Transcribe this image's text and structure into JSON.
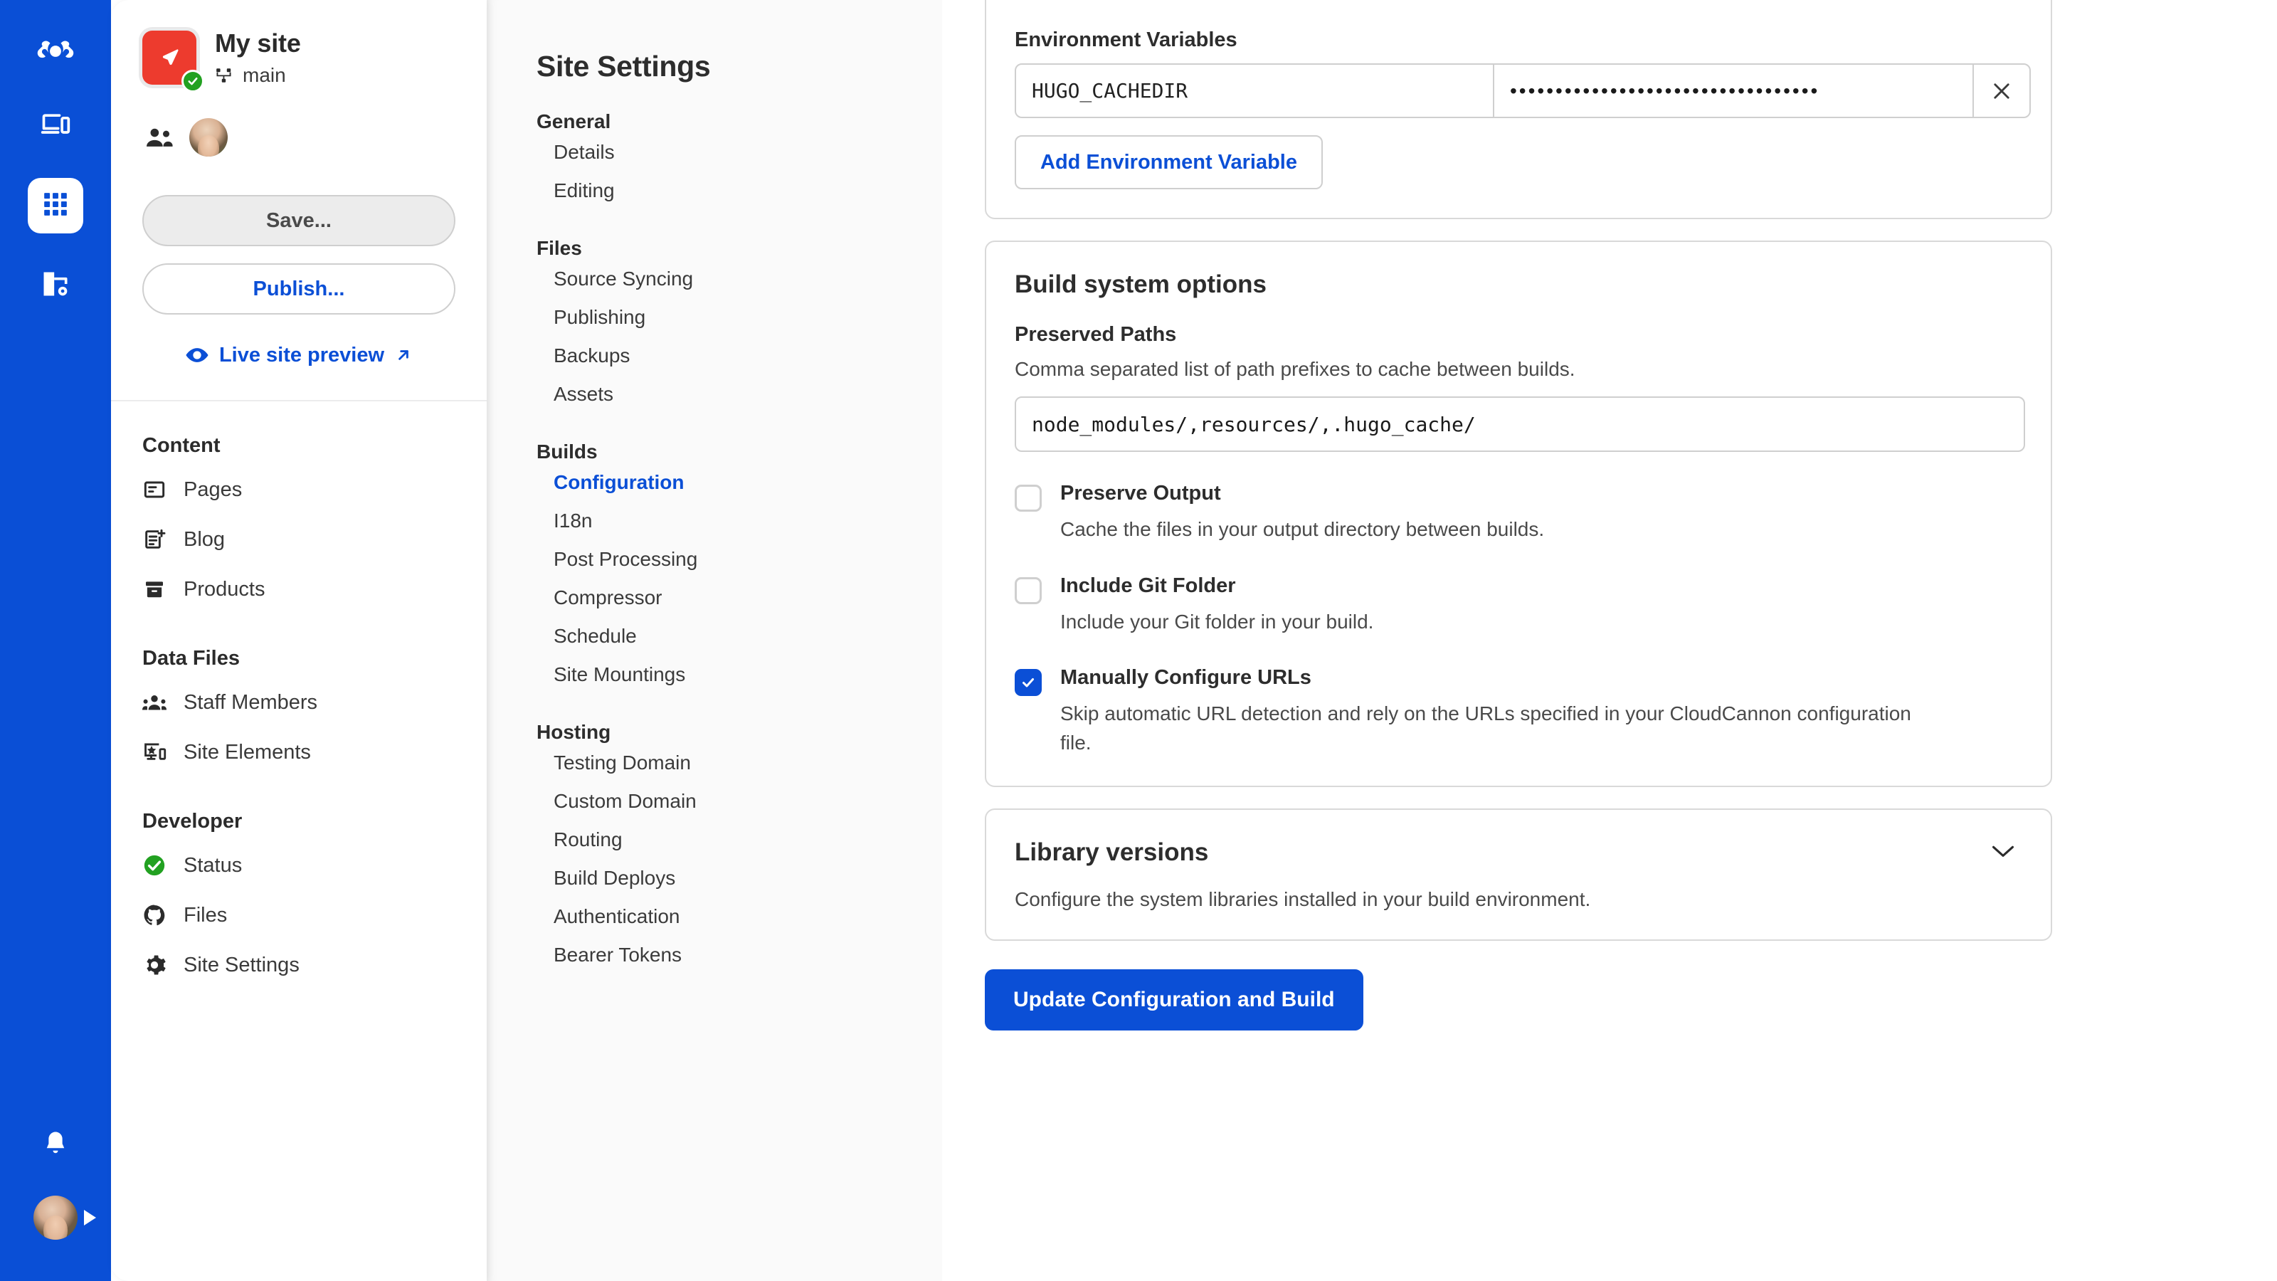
{
  "colors": {
    "rail_blue": "#0A4FD6",
    "accent_blue": "#0B4FD6",
    "site_logo_red": "#ED3B2E",
    "status_green": "#22A121"
  },
  "rail": {
    "logo_icon": "cloudcannon-logo-icon",
    "items": [
      {
        "icon": "devices-preview-icon",
        "active": false
      },
      {
        "icon": "apps-grid-icon",
        "active": true
      },
      {
        "icon": "site-settings-building-icon",
        "active": false
      }
    ],
    "bell_icon": "notification-bell-icon",
    "avatar_icon": "user-avatar",
    "expand_caret_icon": "caret-right-icon"
  },
  "sidebar": {
    "site_name": "My site",
    "branch_icon": "git-branch-icon",
    "branch_name": "main",
    "members_icon": "people-icon",
    "save_label": "Save...",
    "publish_label": "Publish...",
    "live_preview_label": "Live site preview",
    "live_preview_icon": "eye-icon",
    "live_preview_external_icon": "external-link-arrow-icon",
    "groups": [
      {
        "heading": "Content",
        "items": [
          {
            "label": "Pages",
            "icon": "pages-icon"
          },
          {
            "label": "Blog",
            "icon": "blog-post-add-icon"
          },
          {
            "label": "Products",
            "icon": "products-box-icon"
          }
        ]
      },
      {
        "heading": "Data Files",
        "items": [
          {
            "label": "Staff Members",
            "icon": "staff-members-people-icon"
          },
          {
            "label": "Site Elements",
            "icon": "site-elements-screen-icon"
          }
        ]
      },
      {
        "heading": "Developer",
        "items": [
          {
            "label": "Status",
            "icon": "status-check-circle-icon"
          },
          {
            "label": "Files",
            "icon": "github-octocat-icon"
          },
          {
            "label": "Site Settings",
            "icon": "gear-icon"
          }
        ]
      }
    ]
  },
  "settings_nav": {
    "title": "Site Settings",
    "groups": [
      {
        "heading": "General",
        "items": [
          {
            "label": "Details",
            "active": false
          },
          {
            "label": "Editing",
            "active": false
          }
        ]
      },
      {
        "heading": "Files",
        "items": [
          {
            "label": "Source Syncing",
            "active": false
          },
          {
            "label": "Publishing",
            "active": false
          },
          {
            "label": "Backups",
            "active": false
          },
          {
            "label": "Assets",
            "active": false
          }
        ]
      },
      {
        "heading": "Builds",
        "items": [
          {
            "label": "Configuration",
            "active": true
          },
          {
            "label": "I18n",
            "active": false
          },
          {
            "label": "Post Processing",
            "active": false
          },
          {
            "label": "Compressor",
            "active": false
          },
          {
            "label": "Schedule",
            "active": false
          },
          {
            "label": "Site Mountings",
            "active": false
          }
        ]
      },
      {
        "heading": "Hosting",
        "items": [
          {
            "label": "Testing Domain",
            "active": false
          },
          {
            "label": "Custom Domain",
            "active": false
          },
          {
            "label": "Routing",
            "active": false
          },
          {
            "label": "Build Deploys",
            "active": false
          },
          {
            "label": "Authentication",
            "active": false
          },
          {
            "label": "Bearer Tokens",
            "active": false
          }
        ]
      }
    ]
  },
  "main": {
    "env": {
      "label": "Environment Variables",
      "rows": [
        {
          "key": "HUGO_CACHEDIR",
          "value_masked": "••••••••••••••••••••••••••••••••••",
          "delete_icon": "close-x-icon"
        }
      ],
      "add_label": "Add Environment Variable"
    },
    "build_options": {
      "title": "Build system options",
      "preserved_paths_label": "Preserved Paths",
      "preserved_paths_help": "Comma separated list of path prefixes to cache between builds.",
      "preserved_paths_value": "node_modules/,resources/,.hugo_cache/",
      "checkboxes": [
        {
          "title": "Preserve Output",
          "description": "Cache the files in your output directory between builds.",
          "checked": false
        },
        {
          "title": "Include Git Folder",
          "description": "Include your Git folder in your build.",
          "checked": false
        },
        {
          "title": "Manually Configure URLs",
          "description": "Skip automatic URL detection and rely on the URLs specified in your CloudCannon configuration file.",
          "checked": true
        }
      ]
    },
    "library_versions": {
      "title": "Library versions",
      "description": "Configure the system libraries installed in your build environment.",
      "chevron_icon": "chevron-down-icon"
    },
    "submit_label": "Update Configuration and Build"
  }
}
